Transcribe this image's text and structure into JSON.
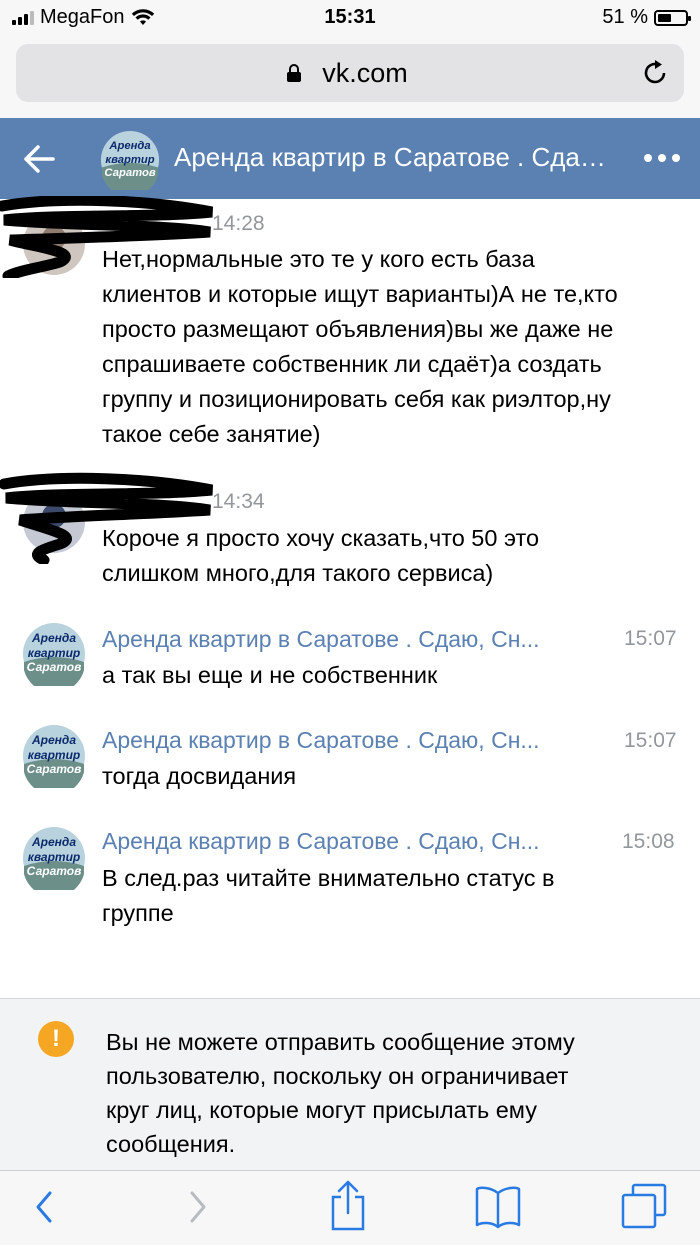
{
  "status_bar": {
    "carrier": "MegaFon",
    "time": "15:31",
    "battery_percent": "51 %",
    "battery_level": 0.51
  },
  "browser": {
    "url": "vk.com"
  },
  "header": {
    "title": "Аренда квартир в Саратове . Сдаю, Сн...",
    "avatar_text": [
      "Аренда",
      "квартир",
      "Саратов"
    ]
  },
  "messages": [
    {
      "name": "",
      "time": "14:28",
      "lines": [
        "Нет,нормальные это те у кого есть база",
        "клиентов и которые ищут варианты)А не те,кто",
        "просто размещают объявления)вы же даже не",
        "спрашиваете собственник ли сдаёт)а создать",
        "группу и позиционировать себя как риэлтор,ну",
        "такое себе занятие)"
      ]
    },
    {
      "name": "",
      "time": "14:34",
      "lines": [
        "Короче я просто хочу сказать,что 50 это",
        "слишком много,для такого сервиса)"
      ]
    },
    {
      "name": "Аренда квартир в Саратове . Сдаю, Сн...",
      "time": "15:07",
      "lines": [
        "а так вы еще и не собственник"
      ]
    },
    {
      "name": "Аренда квартир в Саратове . Сдаю, Сн...",
      "time": "15:07",
      "lines": [
        "тогда досвидания"
      ]
    },
    {
      "name": "Аренда квартир в Саратове . Сдаю, Сн...",
      "time": "15:08",
      "lines": [
        "В след.раз читайте внимательно статус в",
        "группе"
      ]
    }
  ],
  "notice": {
    "icon": "warning-icon",
    "lines": [
      "Вы не можете отправить сообщение этому",
      "пользователю, поскольку он ограничивает",
      "круг лиц, которые могут присылать ему",
      "сообщения."
    ]
  },
  "colors": {
    "header_bg": "#5b80b2",
    "link": "#5b80b2",
    "warning": "#f5a623",
    "time": "#93979b"
  }
}
